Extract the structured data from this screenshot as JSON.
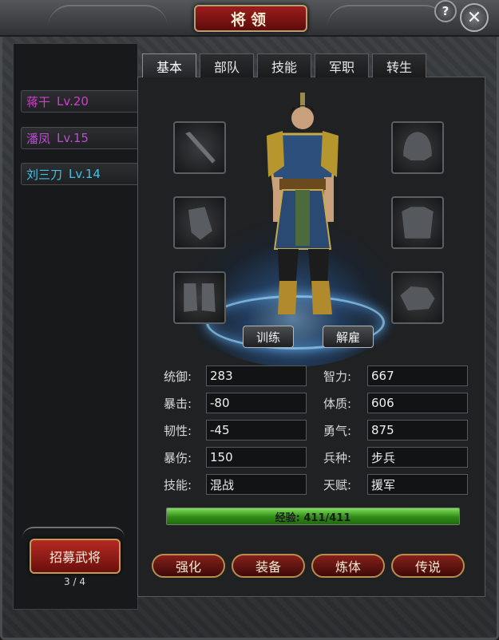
{
  "window": {
    "title": "将领",
    "help_label": "?",
    "close_label": "✕"
  },
  "generals": [
    {
      "name": "蒋干",
      "level": "Lv.20",
      "color": "#d23cd2"
    },
    {
      "name": "潘凤",
      "level": "Lv.15",
      "color": "#b84ed0"
    },
    {
      "name": "刘三刀",
      "level": "Lv.14",
      "color": "#3fc3e8"
    }
  ],
  "recruit": {
    "label": "招募武将",
    "page": "3 / 4"
  },
  "tabs": [
    {
      "label": "基本",
      "active": true
    },
    {
      "label": "部队",
      "active": false
    },
    {
      "label": "技能",
      "active": false
    },
    {
      "label": "军职",
      "active": false
    },
    {
      "label": "转生",
      "active": false
    }
  ],
  "equipment_slots": {
    "left": [
      "weapon-icon",
      "armguard-icon",
      "boots-icon"
    ],
    "right": [
      "helmet-icon",
      "armor-icon",
      "mount-icon"
    ]
  },
  "actions_top": {
    "train": "训练",
    "dismiss": "解雇"
  },
  "stats_left": [
    {
      "label": "统御:",
      "value": "283"
    },
    {
      "label": "暴击:",
      "value": "-80"
    },
    {
      "label": "韧性:",
      "value": "-45"
    },
    {
      "label": "暴伤:",
      "value": "150"
    },
    {
      "label": "技能:",
      "value": "混战"
    }
  ],
  "stats_right": [
    {
      "label": "智力:",
      "value": "667"
    },
    {
      "label": "体质:",
      "value": "606"
    },
    {
      "label": "勇气:",
      "value": "875"
    },
    {
      "label": "兵种:",
      "value": "步兵"
    },
    {
      "label": "天赋:",
      "value": "援军"
    }
  ],
  "experience": {
    "text": "经验: 411/411",
    "fraction": 1.0
  },
  "actions_bottom": [
    "强化",
    "装备",
    "炼体",
    "传说"
  ]
}
